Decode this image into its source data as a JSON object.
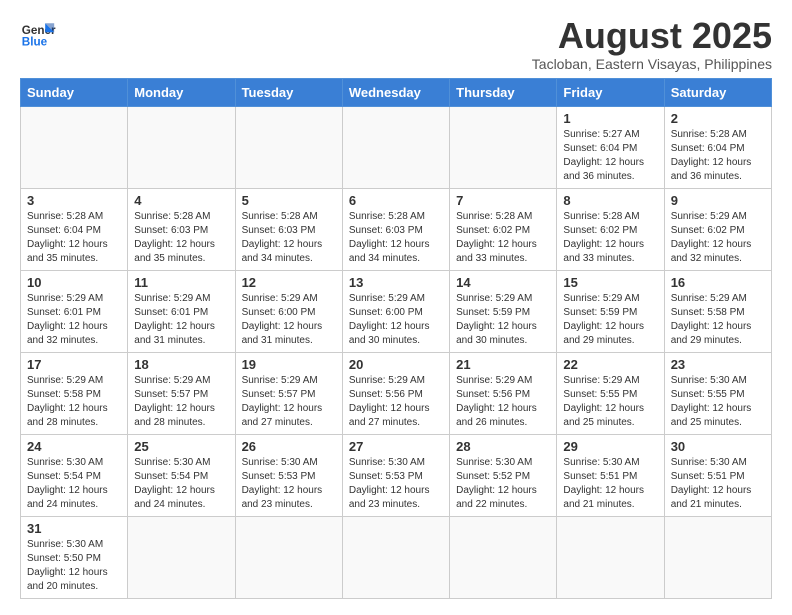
{
  "logo": {
    "text_general": "General",
    "text_blue": "Blue"
  },
  "title": "August 2025",
  "subtitle": "Tacloban, Eastern Visayas, Philippines",
  "weekdays": [
    "Sunday",
    "Monday",
    "Tuesday",
    "Wednesday",
    "Thursday",
    "Friday",
    "Saturday"
  ],
  "days": [
    {
      "date": "",
      "info": ""
    },
    {
      "date": "",
      "info": ""
    },
    {
      "date": "",
      "info": ""
    },
    {
      "date": "",
      "info": ""
    },
    {
      "date": "",
      "info": ""
    },
    {
      "date": "1",
      "info": "Sunrise: 5:27 AM\nSunset: 6:04 PM\nDaylight: 12 hours and 36 minutes."
    },
    {
      "date": "2",
      "info": "Sunrise: 5:28 AM\nSunset: 6:04 PM\nDaylight: 12 hours and 36 minutes."
    },
    {
      "date": "3",
      "info": "Sunrise: 5:28 AM\nSunset: 6:04 PM\nDaylight: 12 hours and 35 minutes."
    },
    {
      "date": "4",
      "info": "Sunrise: 5:28 AM\nSunset: 6:03 PM\nDaylight: 12 hours and 35 minutes."
    },
    {
      "date": "5",
      "info": "Sunrise: 5:28 AM\nSunset: 6:03 PM\nDaylight: 12 hours and 34 minutes."
    },
    {
      "date": "6",
      "info": "Sunrise: 5:28 AM\nSunset: 6:03 PM\nDaylight: 12 hours and 34 minutes."
    },
    {
      "date": "7",
      "info": "Sunrise: 5:28 AM\nSunset: 6:02 PM\nDaylight: 12 hours and 33 minutes."
    },
    {
      "date": "8",
      "info": "Sunrise: 5:28 AM\nSunset: 6:02 PM\nDaylight: 12 hours and 33 minutes."
    },
    {
      "date": "9",
      "info": "Sunrise: 5:29 AM\nSunset: 6:02 PM\nDaylight: 12 hours and 32 minutes."
    },
    {
      "date": "10",
      "info": "Sunrise: 5:29 AM\nSunset: 6:01 PM\nDaylight: 12 hours and 32 minutes."
    },
    {
      "date": "11",
      "info": "Sunrise: 5:29 AM\nSunset: 6:01 PM\nDaylight: 12 hours and 31 minutes."
    },
    {
      "date": "12",
      "info": "Sunrise: 5:29 AM\nSunset: 6:00 PM\nDaylight: 12 hours and 31 minutes."
    },
    {
      "date": "13",
      "info": "Sunrise: 5:29 AM\nSunset: 6:00 PM\nDaylight: 12 hours and 30 minutes."
    },
    {
      "date": "14",
      "info": "Sunrise: 5:29 AM\nSunset: 5:59 PM\nDaylight: 12 hours and 30 minutes."
    },
    {
      "date": "15",
      "info": "Sunrise: 5:29 AM\nSunset: 5:59 PM\nDaylight: 12 hours and 29 minutes."
    },
    {
      "date": "16",
      "info": "Sunrise: 5:29 AM\nSunset: 5:58 PM\nDaylight: 12 hours and 29 minutes."
    },
    {
      "date": "17",
      "info": "Sunrise: 5:29 AM\nSunset: 5:58 PM\nDaylight: 12 hours and 28 minutes."
    },
    {
      "date": "18",
      "info": "Sunrise: 5:29 AM\nSunset: 5:57 PM\nDaylight: 12 hours and 28 minutes."
    },
    {
      "date": "19",
      "info": "Sunrise: 5:29 AM\nSunset: 5:57 PM\nDaylight: 12 hours and 27 minutes."
    },
    {
      "date": "20",
      "info": "Sunrise: 5:29 AM\nSunset: 5:56 PM\nDaylight: 12 hours and 27 minutes."
    },
    {
      "date": "21",
      "info": "Sunrise: 5:29 AM\nSunset: 5:56 PM\nDaylight: 12 hours and 26 minutes."
    },
    {
      "date": "22",
      "info": "Sunrise: 5:29 AM\nSunset: 5:55 PM\nDaylight: 12 hours and 25 minutes."
    },
    {
      "date": "23",
      "info": "Sunrise: 5:30 AM\nSunset: 5:55 PM\nDaylight: 12 hours and 25 minutes."
    },
    {
      "date": "24",
      "info": "Sunrise: 5:30 AM\nSunset: 5:54 PM\nDaylight: 12 hours and 24 minutes."
    },
    {
      "date": "25",
      "info": "Sunrise: 5:30 AM\nSunset: 5:54 PM\nDaylight: 12 hours and 24 minutes."
    },
    {
      "date": "26",
      "info": "Sunrise: 5:30 AM\nSunset: 5:53 PM\nDaylight: 12 hours and 23 minutes."
    },
    {
      "date": "27",
      "info": "Sunrise: 5:30 AM\nSunset: 5:53 PM\nDaylight: 12 hours and 23 minutes."
    },
    {
      "date": "28",
      "info": "Sunrise: 5:30 AM\nSunset: 5:52 PM\nDaylight: 12 hours and 22 minutes."
    },
    {
      "date": "29",
      "info": "Sunrise: 5:30 AM\nSunset: 5:51 PM\nDaylight: 12 hours and 21 minutes."
    },
    {
      "date": "30",
      "info": "Sunrise: 5:30 AM\nSunset: 5:51 PM\nDaylight: 12 hours and 21 minutes."
    },
    {
      "date": "31",
      "info": "Sunrise: 5:30 AM\nSunset: 5:50 PM\nDaylight: 12 hours and 20 minutes."
    }
  ]
}
